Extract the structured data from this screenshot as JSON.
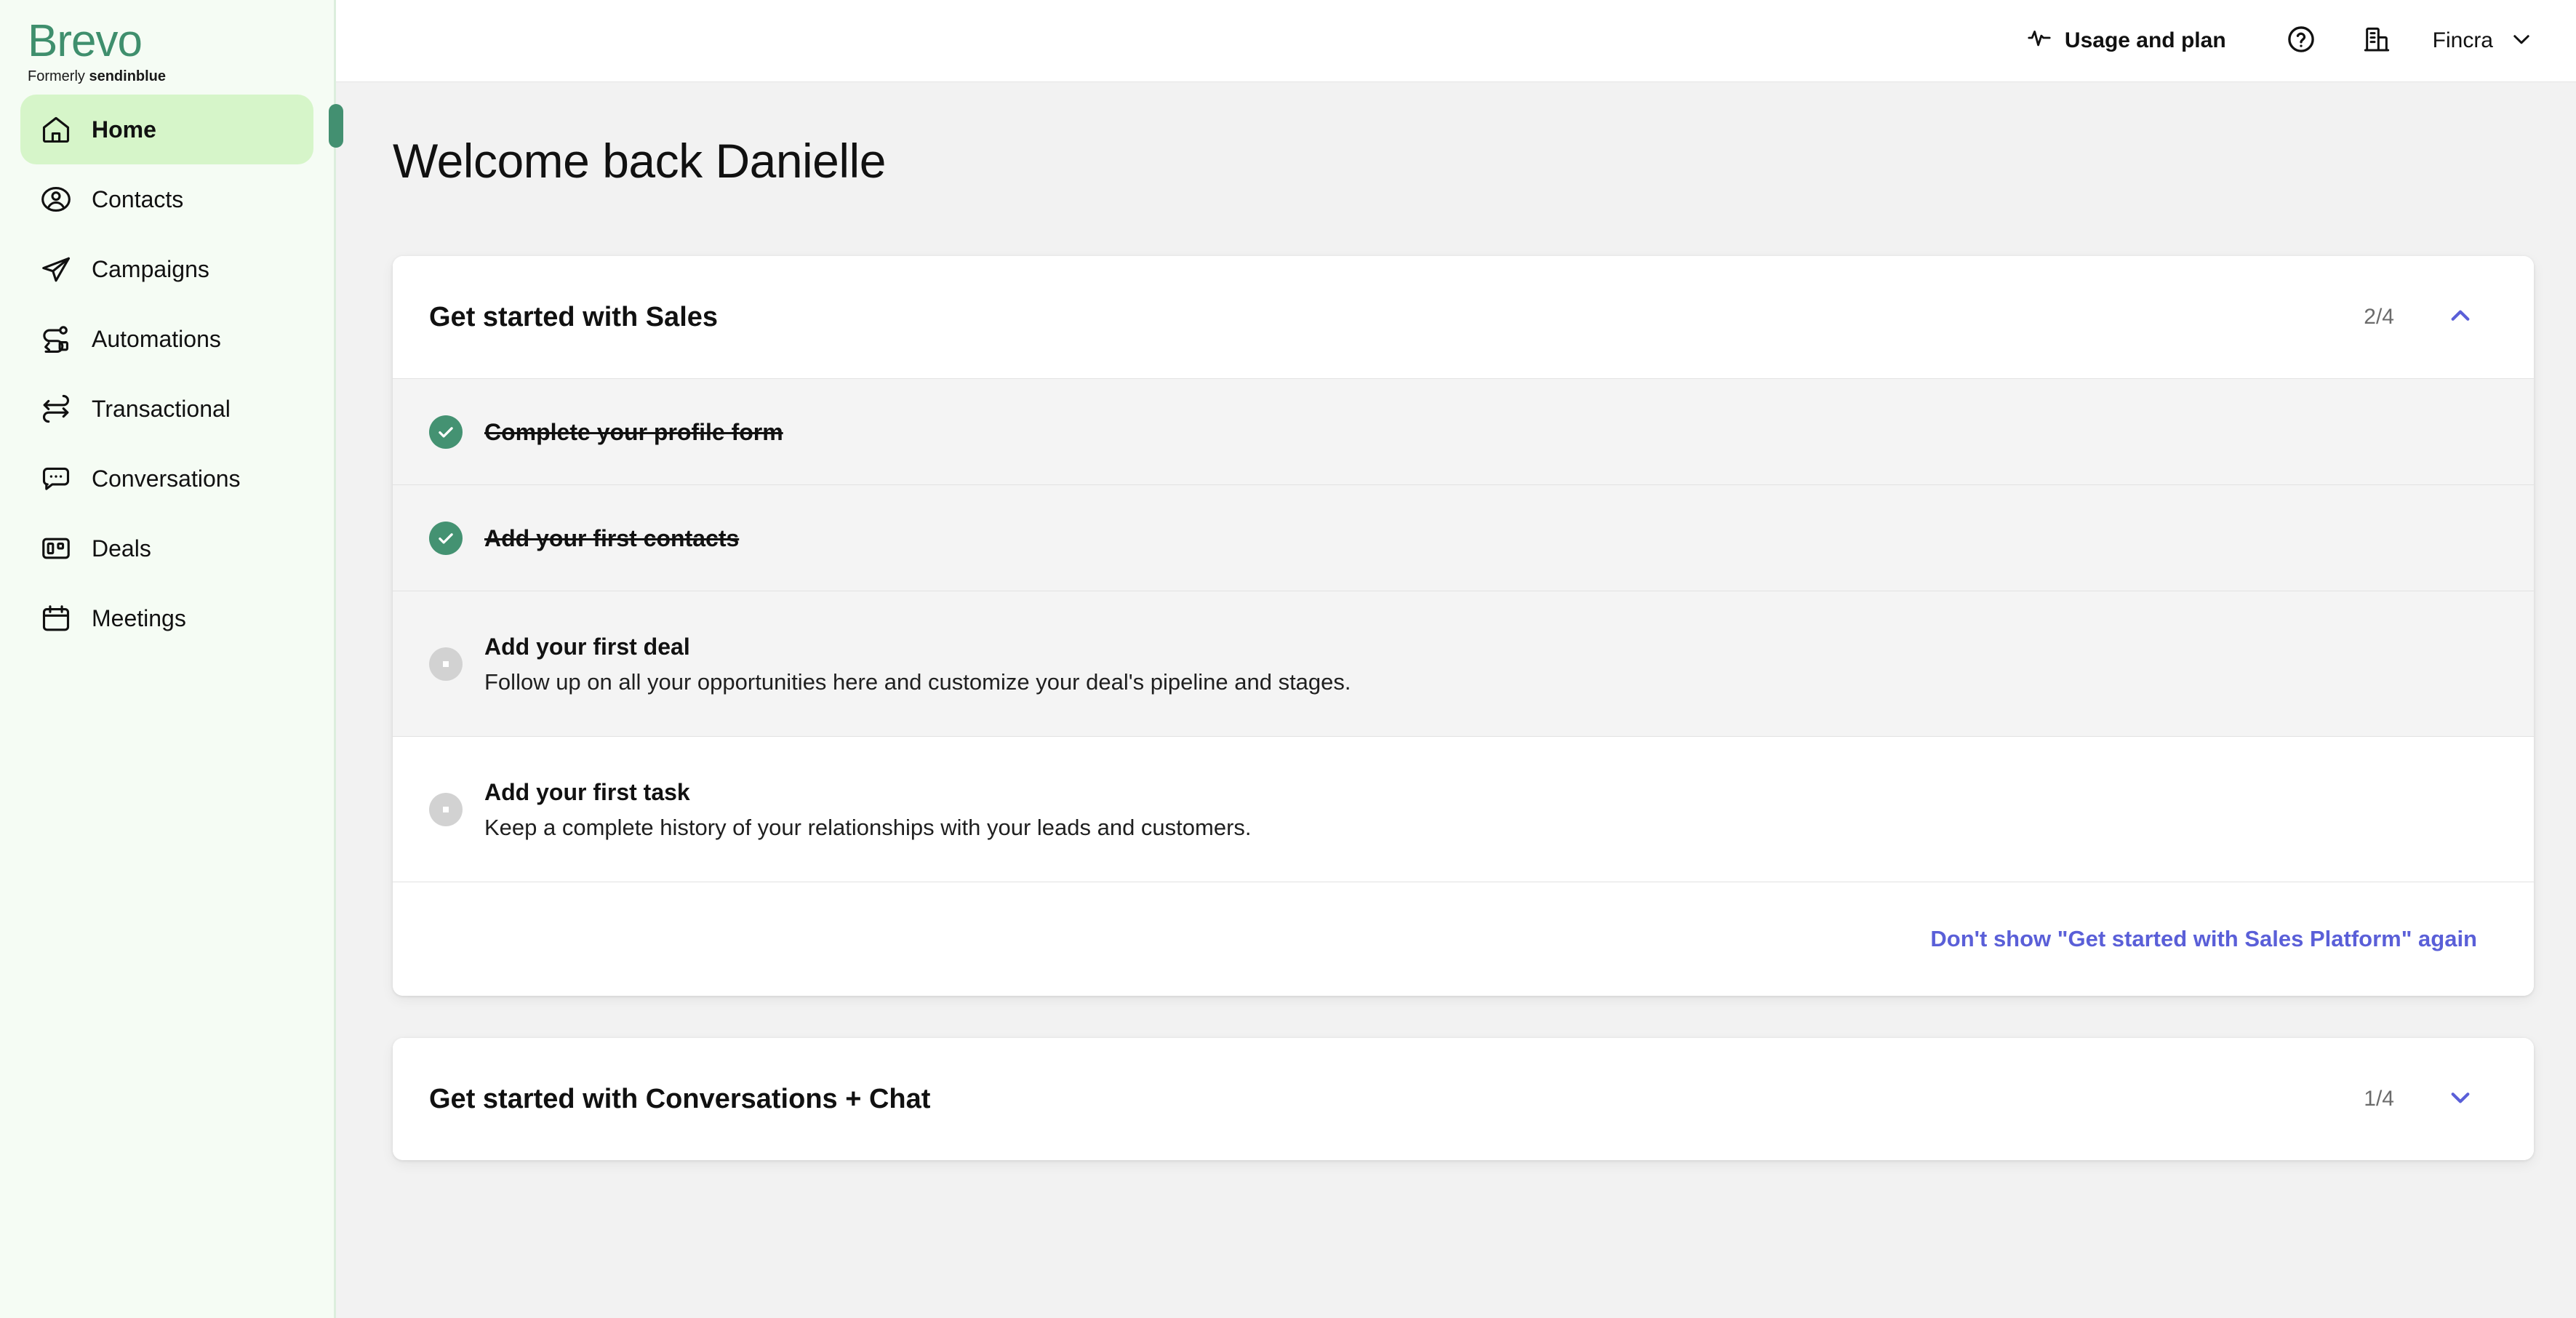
{
  "brand": {
    "wordmark": "Brevo",
    "tagline_prefix": "Formerly ",
    "tagline_bold": "sendinblue",
    "accent_green": "#3f8f6d",
    "active_nav_bg": "#d6f5c9",
    "link_indigo": "#5a5fd8"
  },
  "sidebar": {
    "items": [
      {
        "label": "Home",
        "icon": "home-icon",
        "active": true
      },
      {
        "label": "Contacts",
        "icon": "contacts-icon",
        "active": false
      },
      {
        "label": "Campaigns",
        "icon": "campaigns-icon",
        "active": false
      },
      {
        "label": "Automations",
        "icon": "automations-icon",
        "active": false
      },
      {
        "label": "Transactional",
        "icon": "transactional-icon",
        "active": false
      },
      {
        "label": "Conversations",
        "icon": "conversations-icon",
        "active": false
      },
      {
        "label": "Deals",
        "icon": "deals-icon",
        "active": false
      },
      {
        "label": "Meetings",
        "icon": "meetings-icon",
        "active": false
      }
    ]
  },
  "topbar": {
    "usage_and_plan": "Usage and plan",
    "usage_icon": "activity-pulse-icon",
    "help_icon": "help-circle-icon",
    "company_icon": "building-icon",
    "account_name": "Fincra",
    "account_chevron": "chevron-down-icon"
  },
  "main": {
    "page_title": "Welcome back Danielle"
  },
  "sales_card": {
    "title": "Get started with Sales",
    "progress": "2/4",
    "chevron": "chevron-up-icon",
    "expanded": true,
    "tasks": [
      {
        "label": "Complete your profile form",
        "description": "",
        "completed": true,
        "shaded": true
      },
      {
        "label": "Add your first contacts",
        "description": "",
        "completed": true,
        "shaded": true
      },
      {
        "label": "Add your first deal",
        "description": "Follow up on all your opportunities here and customize your deal's pipeline and stages.",
        "completed": false,
        "shaded": true
      },
      {
        "label": "Add your first task",
        "description": "Keep a complete history of your relationships with your leads and customers.",
        "completed": false,
        "shaded": false
      }
    ],
    "dismiss_label": "Don't show \"Get started with Sales Platform\" again"
  },
  "chat_card": {
    "title": "Get started with Conversations + Chat",
    "progress": "1/4",
    "chevron": "chevron-down-icon",
    "expanded": false
  }
}
